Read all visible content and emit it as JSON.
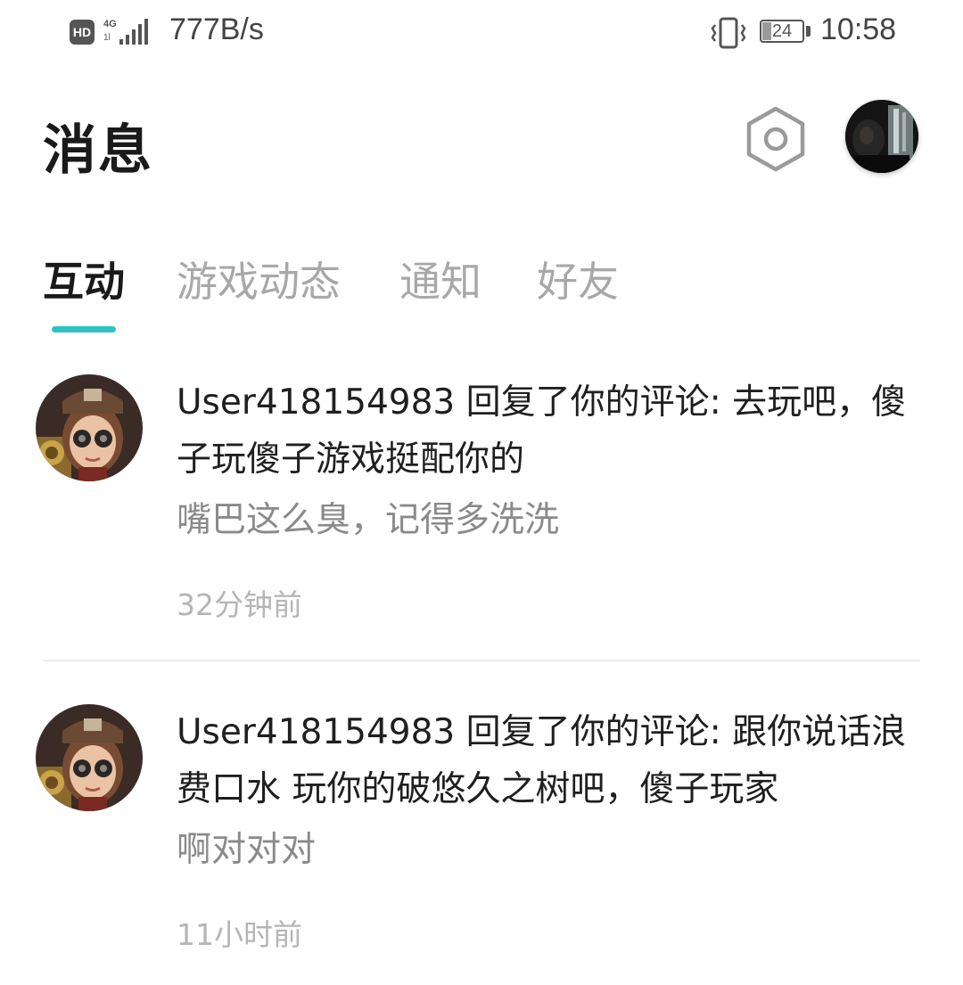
{
  "status_bar": {
    "hd": "HD",
    "network": "4G",
    "speed": "777B/s",
    "battery": "24",
    "time": "10:58"
  },
  "header": {
    "title": "消息",
    "settings_icon": "settings-hexagon-icon",
    "avatar_icon": "user-avatar"
  },
  "tabs": [
    {
      "label": "互动",
      "active": true
    },
    {
      "label": "游戏动态",
      "active": false
    },
    {
      "label": "通知",
      "active": false
    },
    {
      "label": "好友",
      "active": false
    }
  ],
  "messages": [
    {
      "title": "User418154983 回复了你的评论: 去玩吧，傻子玩傻子游戏挺配你的",
      "reply": "嘴巴这么臭，记得多洗洗",
      "time": "32分钟前"
    },
    {
      "title": "User418154983 回复了你的评论: 跟你说话浪费口水 玩你的破悠久之树吧，傻子玩家",
      "reply": "啊对对对",
      "time": "11小时前"
    }
  ],
  "colors": {
    "accent": "#2ec4c4",
    "title_text": "#1a1a1a",
    "inactive_tab": "#a8a8a8",
    "reply_text": "#8a8a8a",
    "time_text": "#b5b5b5"
  }
}
